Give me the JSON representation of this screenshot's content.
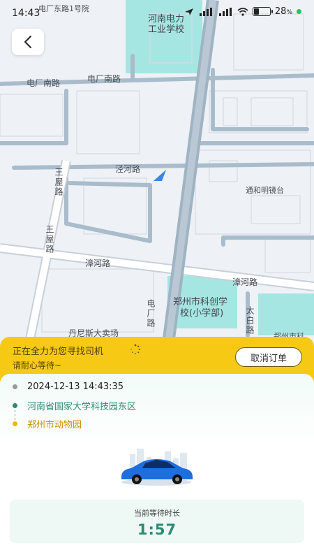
{
  "status_bar": {
    "time": "14:43",
    "battery": "28",
    "battery_unit": "%"
  },
  "map": {
    "labels": {
      "top_road": "电厂东路1号院",
      "school_top": "河南电力",
      "school_top2": "工业学校",
      "road_dianchangnan1": "电厂南路",
      "road_dianchangnan2": "电厂南路",
      "road_jinghe": "泾河路",
      "road_wangwu": "王屋路",
      "road_wangwu2": "王屋路",
      "tonghe": "通和明镜台",
      "road_zhanghe": "漳河路",
      "road_zhanghe2": "漳河路",
      "school_bottom": "郑州市科创学",
      "school_bottom2": "校(小学部)",
      "road_dianchang_v": "电厂路",
      "road_taibai": "太白路",
      "danisi": "丹尼斯大卖场",
      "zhengzhou_right": "郑州市科"
    }
  },
  "order": {
    "status_title": "正在全力为您寻找司机",
    "status_sub": "请耐心等待~",
    "cancel_label": "取消订单",
    "datetime": "2024-12-13 14:43:35",
    "from": "河南省国家大学科技园东区",
    "to": "郑州市动物园",
    "wait_label": "当前等待时长",
    "wait_value": "1:57"
  },
  "colors": {
    "accent_yellow": "#f6c915",
    "green": "#2e8a6e",
    "car_blue": "#1d6fe0"
  }
}
